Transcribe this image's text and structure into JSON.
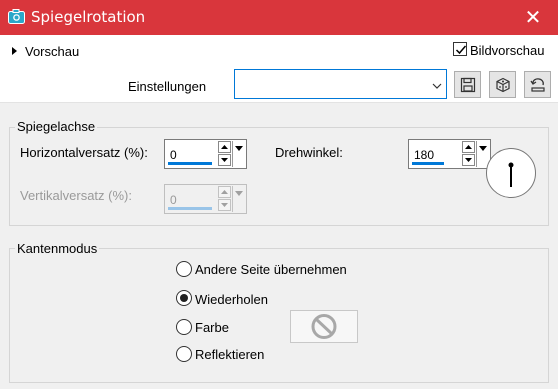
{
  "window": {
    "title": "Spiegelrotation",
    "close_glyph": "✕",
    "colors": {
      "titlebar": "#d9363c",
      "accent": "#0078d7"
    }
  },
  "preview": {
    "label": "Vorschau",
    "bildvorschau_label": "Bildvorschau",
    "bildvorschau_checked": true
  },
  "settings": {
    "label": "Einstellungen",
    "value": "",
    "tools": [
      "save-icon",
      "random-dice-icon",
      "reset-icon"
    ]
  },
  "spiegelachse": {
    "title": "Spiegelachse",
    "horizontal_label": "Horizontalversatz (%):",
    "horizontal_value": "0",
    "vertical_label": "Vertikalversatz (%):",
    "vertical_value": "0",
    "vertical_enabled": false,
    "rotation_label": "Drehwinkel:",
    "rotation_value": "180"
  },
  "kantenmodus": {
    "title": "Kantenmodus",
    "options": [
      {
        "label": "Andere Seite übernehmen",
        "checked": false
      },
      {
        "label": "Wiederholen",
        "checked": true
      },
      {
        "label": "Farbe",
        "checked": false
      },
      {
        "label": "Reflektieren",
        "checked": false
      }
    ],
    "color_swatch_icon": "no-color-icon"
  }
}
